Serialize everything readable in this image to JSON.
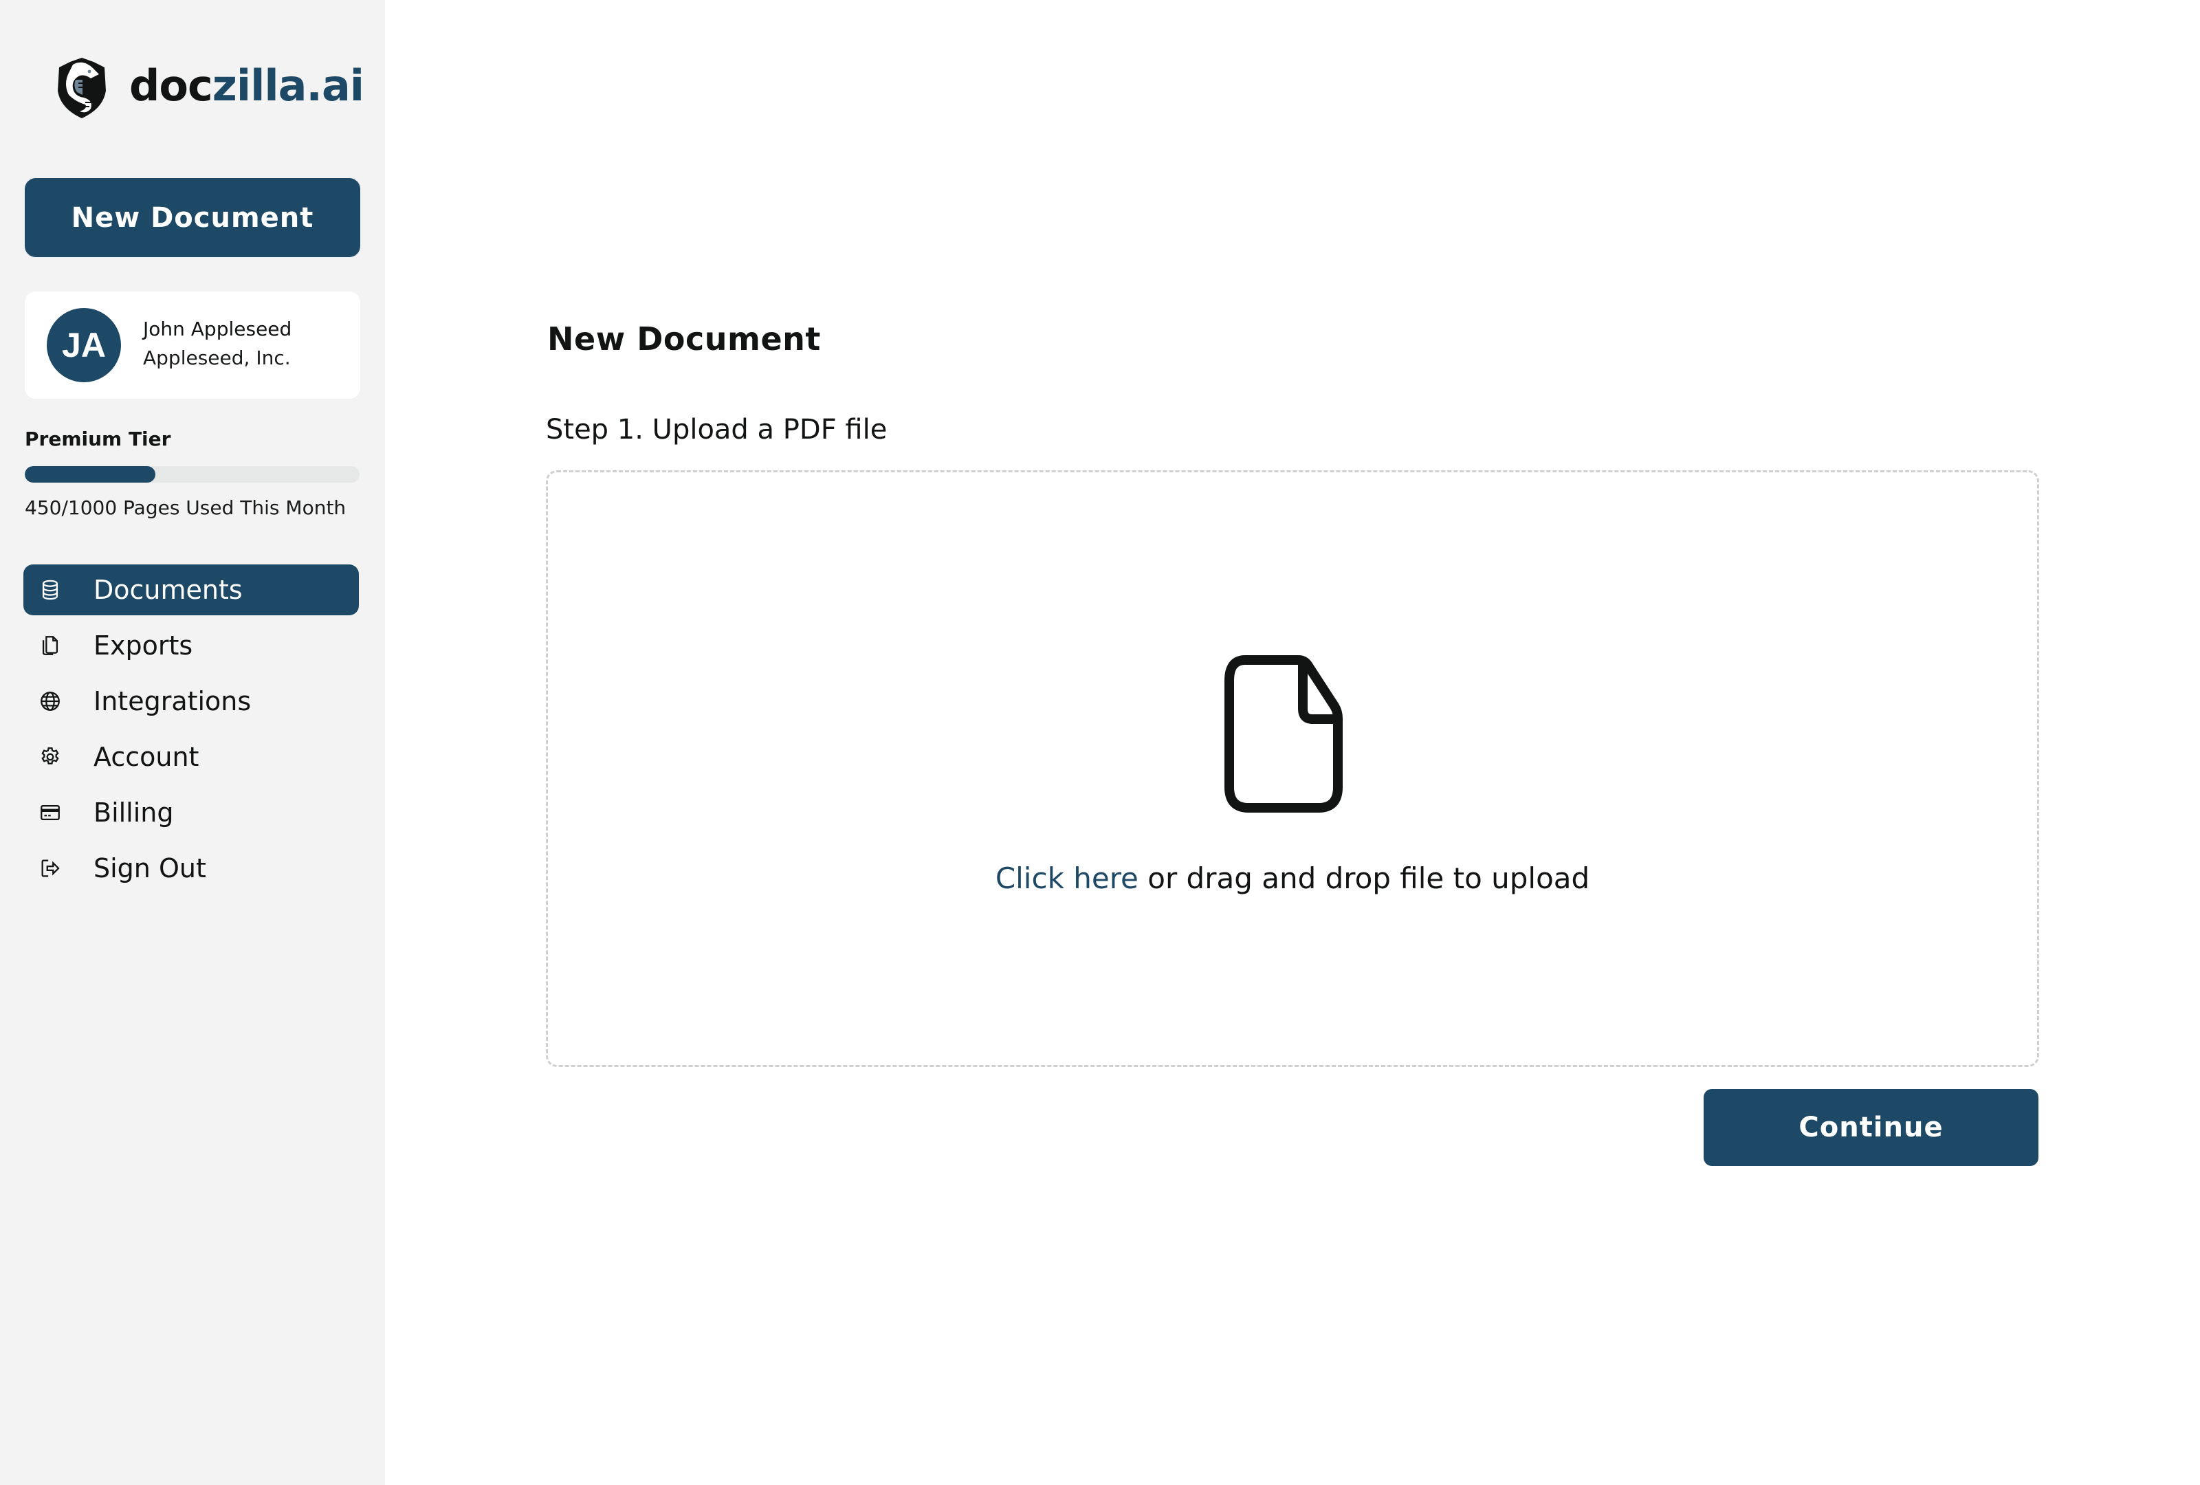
{
  "brand": {
    "name_part1": "doc",
    "name_part2": "zilla.ai",
    "logo_icon": "dragon-shield-icon",
    "accent_color": "#1e4966"
  },
  "sidebar": {
    "new_document_label": "New Document",
    "user": {
      "initials": "JA",
      "name": "John Appleseed",
      "organization": "Appleseed, Inc."
    },
    "plan": {
      "tier_label": "Premium Tier",
      "usage_text": "450/1000 Pages Used This Month",
      "pages_used": 450,
      "pages_limit": 1000,
      "bar_fill_fraction": 0.39
    },
    "nav": [
      {
        "label": "Documents",
        "icon": "database-icon",
        "active": true
      },
      {
        "label": "Exports",
        "icon": "copy-files-icon",
        "active": false
      },
      {
        "label": "Integrations",
        "icon": "globe-icon",
        "active": false
      },
      {
        "label": "Account",
        "icon": "gear-icon",
        "active": false
      },
      {
        "label": "Billing",
        "icon": "credit-card-icon",
        "active": false
      },
      {
        "label": "Sign Out",
        "icon": "sign-out-icon",
        "active": false
      }
    ]
  },
  "main": {
    "title": "New Document",
    "step_label": "Step 1. Upload a PDF file",
    "dropzone": {
      "icon": "file-icon",
      "link_text": "Click here",
      "rest_text": " or drag and drop file to upload"
    },
    "continue_label": "Continue"
  }
}
